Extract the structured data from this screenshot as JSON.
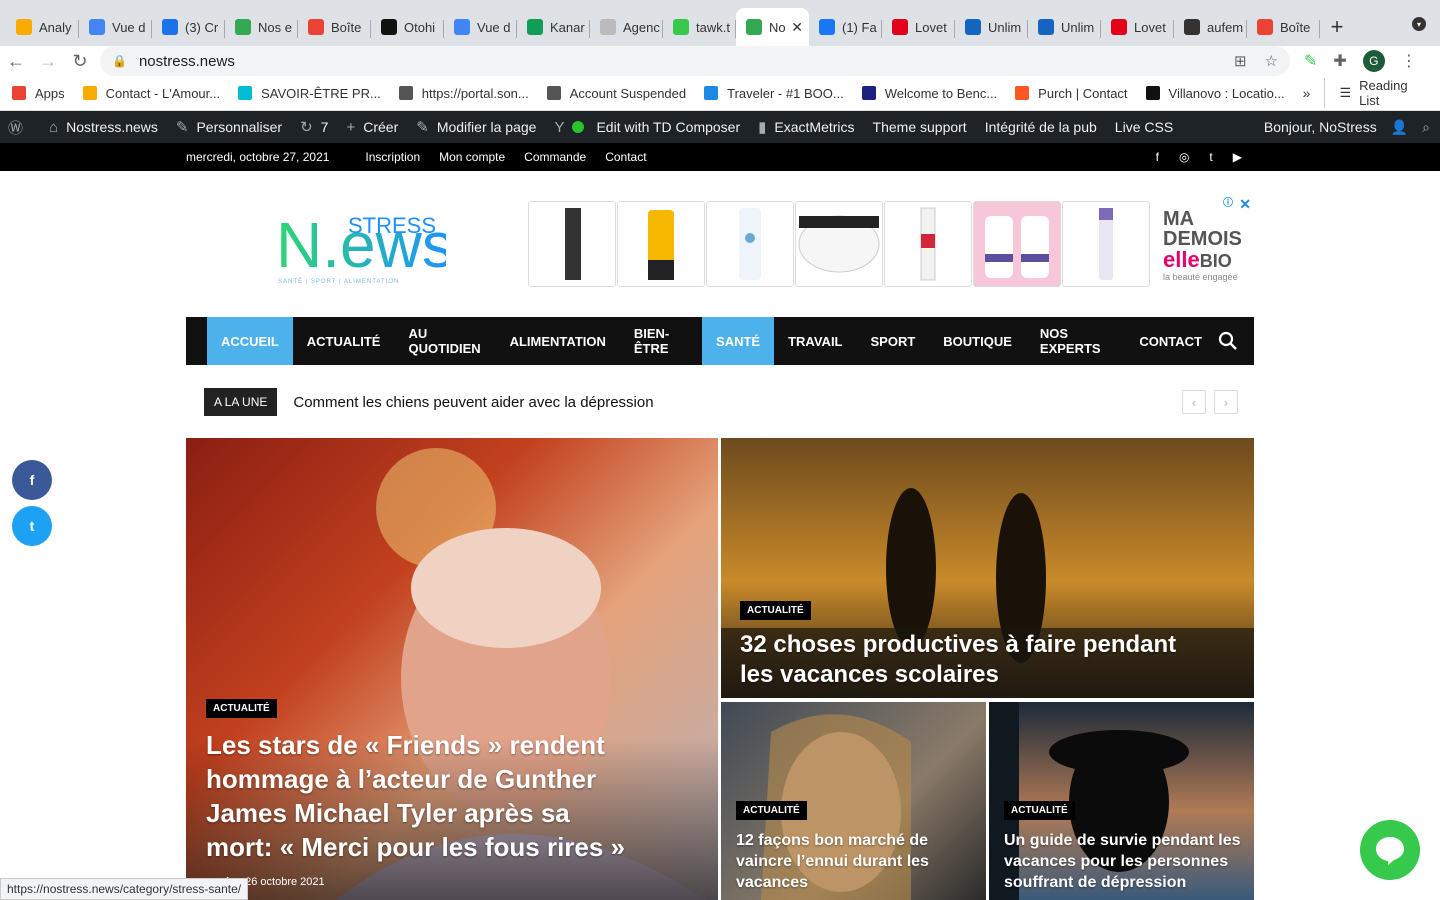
{
  "browser": {
    "tabs": [
      {
        "label": "Analy",
        "color": "#f9ab00"
      },
      {
        "label": "Vue d",
        "color": "#4285f4"
      },
      {
        "label": "(3) Cr",
        "color": "#1a73e8"
      },
      {
        "label": "Nos e",
        "color": "#34a853"
      },
      {
        "label": "Boîte",
        "color": "#ea4335"
      },
      {
        "label": "Otohi",
        "color": "#111111"
      },
      {
        "label": "Vue d",
        "color": "#4285f4"
      },
      {
        "label": "Kanar",
        "color": "#0f9d58"
      },
      {
        "label": "Agenc",
        "color": "#bbbbbb"
      },
      {
        "label": "tawk.t",
        "color": "#37c94c"
      },
      {
        "label": "No",
        "color": "#34a853",
        "active": true
      },
      {
        "label": "(1) Fa",
        "color": "#1877f2"
      },
      {
        "label": "Lovet",
        "color": "#e2001a"
      },
      {
        "label": "Unlim",
        "color": "#1565c0"
      },
      {
        "label": "Unlim",
        "color": "#1565c0"
      },
      {
        "label": "Lovet",
        "color": "#e2001a"
      },
      {
        "label": "aufem",
        "color": "#333333"
      },
      {
        "label": "Boîte",
        "color": "#ea4335"
      }
    ],
    "url": "nostress.news",
    "profile_initial": "G",
    "bookmarks": [
      {
        "label": "Apps",
        "color": "#ea4335"
      },
      {
        "label": "Contact - L'Amour...",
        "color": "#f9ab00"
      },
      {
        "label": "SAVOIR-ÊTRE PR...",
        "color": "#00bcd4"
      },
      {
        "label": "https://portal.son...",
        "color": "#555555"
      },
      {
        "label": "Account Suspended",
        "color": "#555555"
      },
      {
        "label": "Traveler - #1 BOO...",
        "color": "#1e88e5"
      },
      {
        "label": "Welcome to Benc...",
        "color": "#1a237e"
      },
      {
        "label": "Purch | Contact",
        "color": "#ff5722"
      },
      {
        "label": "Villanovo : Locatio...",
        "color": "#111111"
      }
    ],
    "reading_list": "Reading List",
    "more": "»",
    "status_url": "https://nostress.news/category/stress-sante/"
  },
  "wpbar": {
    "site": "Nostress.news",
    "customize": "Personnaliser",
    "updates": "7",
    "create": "Créer",
    "edit": "Modifier la page",
    "td": "Edit with TD Composer",
    "metrics": "ExactMetrics",
    "support": "Theme support",
    "integrity": "Intégrité de la pub",
    "css": "Live CSS",
    "greeting": "Bonjour, NoStress"
  },
  "topbar": {
    "date": "mercredi, octobre 27, 2021",
    "links": [
      "Inscription",
      "Mon compte",
      "Commande",
      "Contact"
    ],
    "social": [
      "f",
      "◎",
      "t",
      "▶"
    ]
  },
  "logo": {
    "stress": "STRESS",
    "news": "N.ews",
    "tagline": "SANTÉ | SPORT | ALIMENTATION"
  },
  "ad": {
    "brand1": "MA",
    "brand2": "DEMOIS",
    "brand3": "elle",
    "brand4": "BIO",
    "slogan": "la beauté engagée"
  },
  "nav": {
    "items": [
      "ACCUEIL",
      "ACTUALITÉ",
      "AU QUOTIDIEN",
      "ALIMENTATION",
      "BIEN-ÊTRE",
      "SANTÉ",
      "TRAVAIL",
      "SPORT",
      "BOUTIQUE",
      "NOS EXPERTS",
      "CONTACT"
    ],
    "active": [
      0,
      5
    ]
  },
  "ticker": {
    "label": "A LA UNE",
    "text": "Comment les chiens peuvent aider avec la dépression"
  },
  "articles": [
    {
      "category": "ACTUALITÉ",
      "title": "Les stars de « Friends » rendent hommage à l’acteur de Gunther James Michael Tyler après sa mort: « Merci pour les fous rires »",
      "author": "maria",
      "date": "26 octobre 2021"
    },
    {
      "category": "ACTUALITÉ",
      "title": "32 choses productives à faire pendant les vacances scolaires"
    },
    {
      "category": "ACTUALITÉ",
      "title": "12 façons bon marché de vaincre l’ennui durant les vacances"
    },
    {
      "category": "ACTUALITÉ",
      "title": "Un guide de survie pendant les vacances pour les personnes souffrant de dépression"
    }
  ],
  "share": [
    "f",
    "t"
  ]
}
